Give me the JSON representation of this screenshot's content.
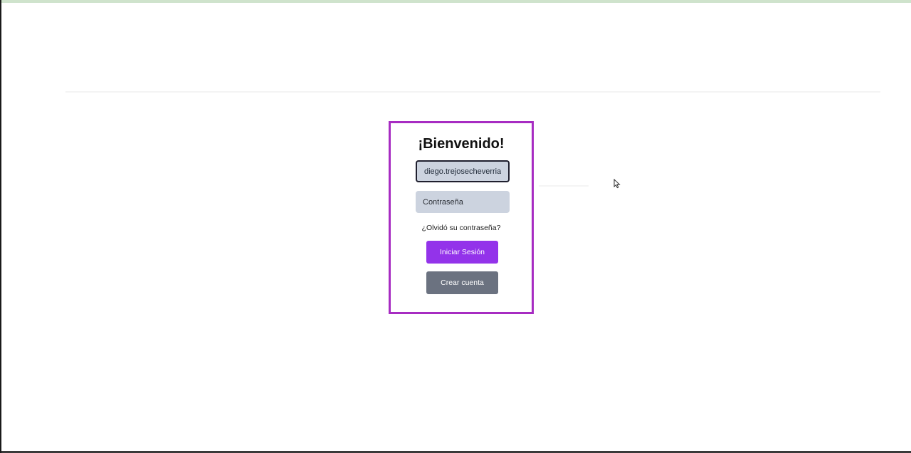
{
  "login": {
    "title": "¡Bienvenido!",
    "username_value": "diego.trejosecheverria",
    "password_placeholder": "Contraseña",
    "forgot_link": "¿Olvidó su contraseña?",
    "login_button": "Iniciar Sesión",
    "create_account_button": "Crear cuenta"
  },
  "colors": {
    "card_border": "#a72cc2",
    "field_bg": "#ccd3df",
    "login_button": "#9333ea",
    "create_button": "#6b7280"
  },
  "icons": {
    "cursor": "mouse-pointer-icon"
  }
}
